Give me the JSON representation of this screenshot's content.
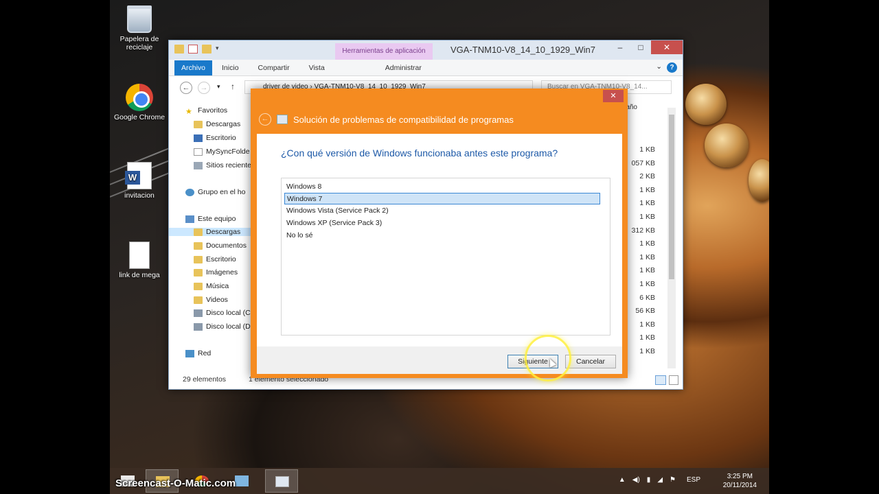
{
  "desktop": {
    "icons": [
      {
        "label": "Papelera de reciclaje"
      },
      {
        "label": "Google Chrome"
      },
      {
        "label": "invitacion"
      },
      {
        "label": "link de mega"
      }
    ]
  },
  "explorer": {
    "contextual_tab": "Herramientas de aplicación",
    "title": "VGA-TNM10-V8_14_10_1929_Win7",
    "ribbon_tabs": [
      "Archivo",
      "Inicio",
      "Compartir",
      "Vista",
      "Administrar"
    ],
    "address": {
      "path_1": "driver de video",
      "path_2": "VGA-TNM10-V8_14_10_1929_Win7"
    },
    "search_placeholder": "Buscar en VGA-TNM10-V8_14...",
    "column_fragment": "año",
    "nav": {
      "favorites": "Favoritos",
      "favorites_items": [
        "Descargas",
        "Escritorio",
        "MySyncFolde",
        "Sitios reciente"
      ],
      "homegroup": "Grupo en el ho",
      "this_pc": "Este equipo",
      "this_pc_items": [
        "Descargas",
        "Documentos",
        "Escritorio",
        "Imágenes",
        "Música",
        "Videos",
        "Disco local (C",
        "Disco local (D"
      ],
      "network": "Red"
    },
    "sizes": [
      "1 KB",
      "057 KB",
      "2 KB",
      "1 KB",
      "1 KB",
      "1 KB",
      "312 KB",
      "1 KB",
      "1 KB",
      "1 KB",
      "1 KB",
      "6 KB",
      "56 KB",
      "1 KB",
      "1 KB",
      "1 KB"
    ],
    "status": {
      "count": "29 elementos",
      "selected": "1 elemento seleccionado"
    }
  },
  "dialog": {
    "title": "Solución de problemas de compatibilidad de programas",
    "question": "¿Con qué versión de Windows funcionaba antes este programa?",
    "options": [
      "Windows 8",
      "Windows 7",
      "Windows Vista (Service Pack 2)",
      "Windows XP (Service Pack 3)",
      "No lo sé"
    ],
    "selected_option": "Windows 7",
    "next_label": "Siguiente",
    "cancel_label": "Cancelar",
    "close_label": "✕"
  },
  "taskbar": {
    "language": "ESP",
    "time": "3:25 PM",
    "date": "20/11/2014"
  },
  "watermark": "Screencast-O-Matic.com",
  "colors": {
    "dialog_accent": "#f58b20",
    "question_text": "#1e5aa8",
    "selection": "#cfe4f7"
  }
}
